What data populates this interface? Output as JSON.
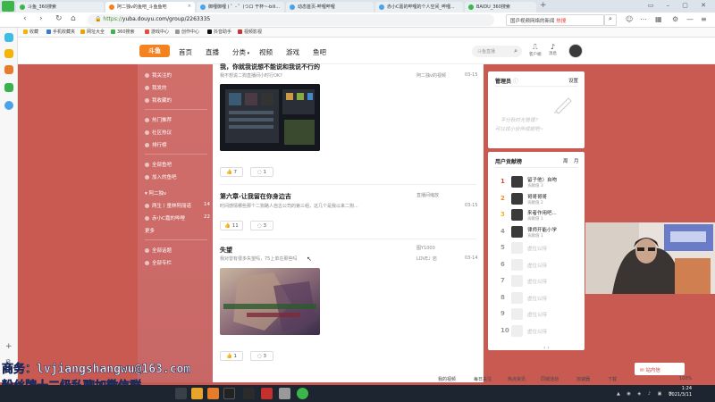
{
  "browser": {
    "tabs": [
      {
        "label": "斗鱼_360搜索",
        "active": false,
        "color": "#3cb54a"
      },
      {
        "label": "阿二独v的鱼吧_斗鱼鱼吧",
        "active": true,
        "color": "#f58220"
      },
      {
        "label": "御哩御哩 ( ゜- ゜)つロ 干杯~-bili...",
        "active": false,
        "color": "#4aa3e8"
      },
      {
        "label": "动态首页-哔哩哔哩",
        "active": false,
        "color": "#4aa3e8"
      },
      {
        "label": "赤小C嘉的哔哩的个人空间_哔哩...",
        "active": false,
        "color": "#4aa3e8"
      },
      {
        "label": "BAIDU_360搜索",
        "active": false,
        "color": "#3cb54a"
      }
    ],
    "new_tab": "+",
    "url_scheme": "https://",
    "url_host": "yuba.douyu.com",
    "url_path": "/group/2263335",
    "search_text": "国乒视频网络的新闻",
    "search_badge": "热搜",
    "bookmarks": [
      "收藏",
      "手机收藏夹",
      "网址大全",
      "360搜索",
      "游戏中心",
      "创作中心",
      "抖音助手",
      "视频影视"
    ]
  },
  "site": {
    "logo": "斗鱼",
    "nav": [
      "首页",
      "直播",
      "分类",
      "视频",
      "游戏",
      "鱼吧"
    ],
    "search_placeholder": "斗鱼直播",
    "header_icons": [
      {
        "icon": "user-icon",
        "label": "客户端"
      },
      {
        "icon": "bell-icon",
        "label": "消息"
      }
    ]
  },
  "left_menu": {
    "top_items": [
      "我关注的",
      "我发的",
      "我收藏的"
    ],
    "mid_items": [
      "热门推荐",
      "社区热议",
      "排行榜"
    ],
    "group_items": [
      "全部鱼吧",
      "加入的鱼吧"
    ],
    "groups": [
      {
        "name": "阿二独v",
        "count": ""
      },
      {
        "name": "两生丨童林阿丽诺",
        "count": "14"
      },
      {
        "name": "赤小C嘉的哔哩",
        "count": "22"
      },
      {
        "name": "更多",
        "count": ""
      }
    ],
    "bottom_items": [
      "全部话题",
      "全部专栏"
    ]
  },
  "posts": [
    {
      "title": "我，你就我说想不能说和我说不行的",
      "subtitle": "我不想说二狗直播间小时行OK?",
      "author": "阿二独v的视频",
      "date": "03-15",
      "likes": "7",
      "comments": "1"
    },
    {
      "title": "第六章-让我留在你身边吉",
      "subtitle": "时间感情哪些那个二狗路人自古公司的第三组，这几个是我以来二狗...",
      "author": "直播间缩放",
      "date": "03-15",
      "likes": "11",
      "comments": "3"
    },
    {
      "title": "失望",
      "subtitle": "我对曾有很多失望吗，75上单在那些吗",
      "author_top": "图Y1000",
      "author": "LOVE♪ 岩",
      "date": "03-14",
      "likes": "1",
      "comments": "3"
    }
  ],
  "admin_panel": {
    "title": "管理员",
    "action": "设置",
    "empty_line1": "平分秋时光管理？",
    "empty_line2": "可以找小伙伴成就吧~"
  },
  "rank_panel": {
    "title": "用户贡献榜",
    "tabs": [
      "周",
      "月"
    ],
    "rows": [
      {
        "rank": "1",
        "name": "留子他〉自吻",
        "sub": "贡献值 3"
      },
      {
        "rank": "2",
        "name": "哥哥哥哥",
        "sub": "贡献值 2"
      },
      {
        "rank": "3",
        "name": "来者作用吧...",
        "sub": "贡献值 1"
      },
      {
        "rank": "4",
        "name": "律师开能小学",
        "sub": "贡献值 1"
      },
      {
        "rank": "5",
        "name": "虚位以待",
        "sub": ""
      },
      {
        "rank": "6",
        "name": "虚位以待",
        "sub": ""
      },
      {
        "rank": "7",
        "name": "虚位以待",
        "sub": ""
      },
      {
        "rank": "8",
        "name": "虚位以待",
        "sub": ""
      },
      {
        "rank": "9",
        "name": "虚位以待",
        "sub": ""
      },
      {
        "rank": "10",
        "name": "虚位以待",
        "sub": ""
      }
    ],
    "pager": "‹ ›"
  },
  "overlay": {
    "line1": "商务：lvjiangshangwu@163.com",
    "line2": "粉丝牌十二级私聊加微信群"
  },
  "statusbar": [
    "我的视频",
    "每日关注",
    "热点资讯",
    "同城活动",
    "加速器",
    "下载",
    "100%"
  ],
  "read_popup": "站内信",
  "clock": {
    "time": "1:24",
    "date": "2021/3/11"
  },
  "colors": {
    "brand": "#f58220",
    "bg": "#c85a52",
    "rank_hot": "#e04a3a"
  }
}
